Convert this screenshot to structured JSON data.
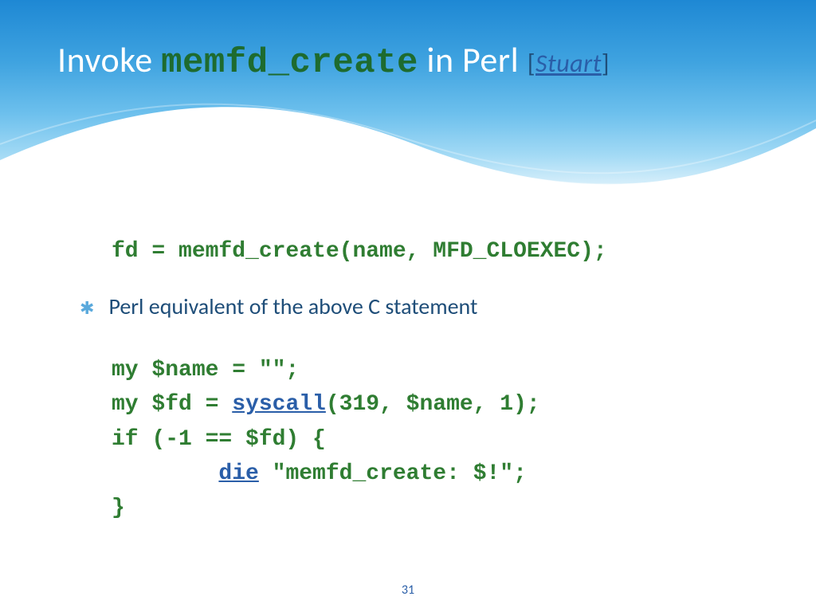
{
  "title": {
    "pre": "Invoke ",
    "mono": "memfd_create",
    "post": " in Perl ",
    "ref_open": "[",
    "ref_link": "Stuart",
    "ref_close": "]"
  },
  "c_code": "fd = memfd_create(name, MFD_CLOEXEC);",
  "bullet_text": "Perl equivalent of the above C statement",
  "perl": {
    "l1": "my $name = \"\";",
    "l2a": "my $fd = ",
    "l2link": "syscall",
    "l2b": "(319, $name, 1);",
    "l3": "if (-1 == $fd) {",
    "l4pad": "        ",
    "l4link": "die",
    "l4b": " \"memfd_create: $!\";",
    "l5": "}"
  },
  "page_number": "31"
}
